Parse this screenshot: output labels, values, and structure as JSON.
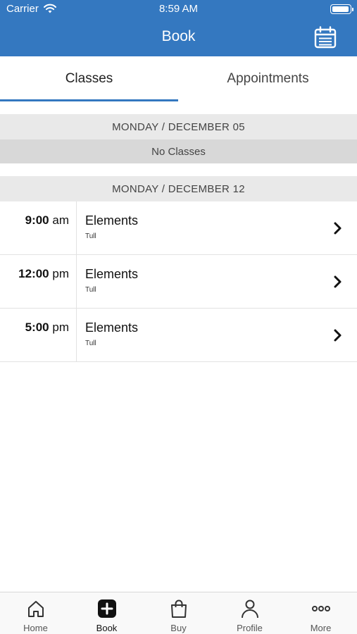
{
  "status_bar": {
    "carrier": "Carrier",
    "time": "8:59 AM",
    "battery_level": 1.0
  },
  "header": {
    "title": "Book",
    "right_icon": "calendar-icon"
  },
  "tabs": [
    {
      "label": "Classes",
      "selected": true
    },
    {
      "label": "Appointments",
      "selected": false
    }
  ],
  "days": [
    {
      "date": "MONDAY / DECEMBER 05",
      "empty_message": "No Classes",
      "classes": []
    },
    {
      "date": "MONDAY / DECEMBER 12",
      "classes": [
        {
          "time": "9:00",
          "suffix": "am",
          "name": "Elements",
          "instructor": "Tull"
        },
        {
          "time": "12:00",
          "suffix": "pm",
          "name": "Elements",
          "instructor": "Tull"
        },
        {
          "time": "5:00",
          "suffix": "pm",
          "name": "Elements",
          "instructor": "Tull"
        }
      ]
    }
  ],
  "tab_bar": [
    {
      "label": "Home",
      "icon": "home-icon",
      "active": false
    },
    {
      "label": "Book",
      "icon": "plus-icon",
      "active": true
    },
    {
      "label": "Buy",
      "icon": "shopping-bag-icon",
      "active": false
    },
    {
      "label": "Profile",
      "icon": "user-icon",
      "active": false
    },
    {
      "label": "More",
      "icon": "more-icon",
      "active": false
    }
  ],
  "colors": {
    "accent": "#3478c0",
    "section_header_bg": "#e9e9e9",
    "empty_row_bg": "#d8d8d8"
  }
}
